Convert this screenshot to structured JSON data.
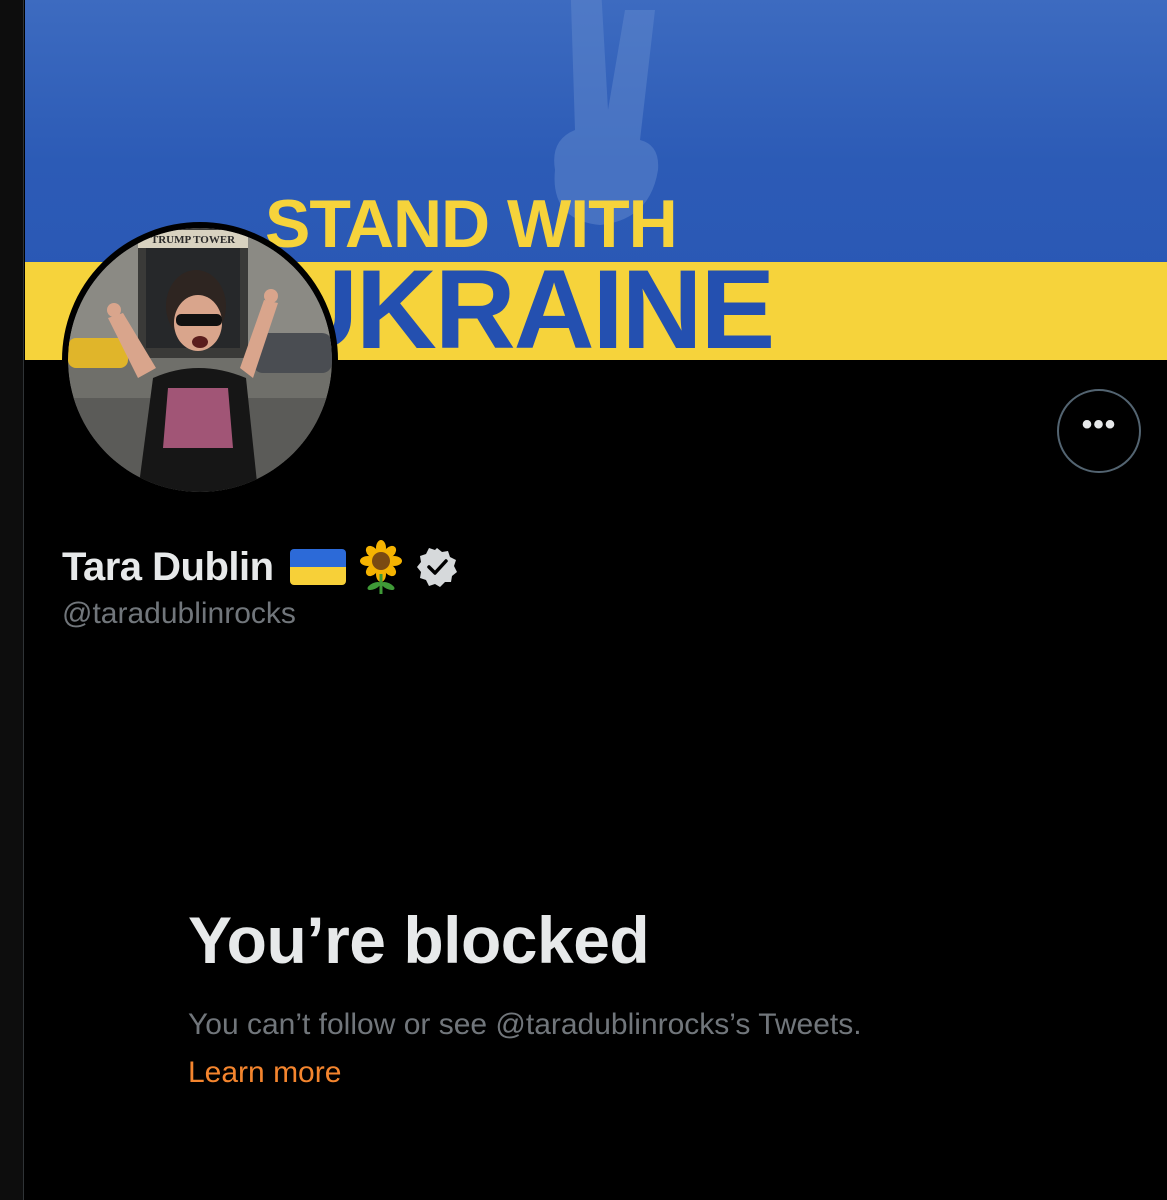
{
  "banner": {
    "line1": "STAND WITH",
    "line2": "UKRAINE",
    "sign_text": "TRUMP TOWER"
  },
  "profile": {
    "display_name": "Tara Dublin",
    "handle": "@taradublinrocks",
    "badges": [
      "ukraine-flag-icon",
      "sunflower-icon",
      "verified-icon"
    ]
  },
  "actions": {
    "more_label": "•••"
  },
  "blocked": {
    "title": "You’re blocked",
    "message": "You can’t follow or see @taradublinrocks’s Tweets.",
    "learn_more": "Learn more"
  },
  "colors": {
    "background": "#000000",
    "banner_blue": "#2c5bb6",
    "banner_yellow": "#f6d33b",
    "text_primary": "#e7e9ea",
    "text_secondary": "#71767b",
    "link": "#f4852e"
  }
}
